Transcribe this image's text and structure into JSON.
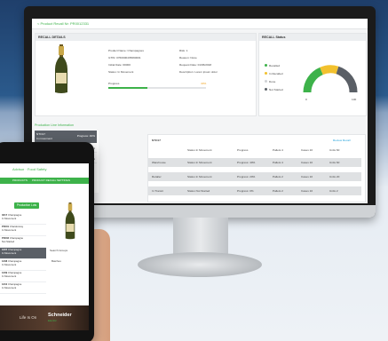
{
  "desktop": {
    "breadcrumb": "< Product Recall Nr: PR0012331",
    "recall_details": {
      "title": "RECALL DETAILS",
      "left_fields": [
        "Product Name: Champagnes",
        "GTIN: 0760000435690001",
        "Initial Date: 00000",
        "Status: In Movement"
      ],
      "right_fields": [
        "Risk: 1",
        "Reason: None",
        "Request Date: 01/06/2018",
        "Description: Lorem ipsum dolor"
      ],
      "progress_label": "Progress",
      "progress_value": "40%",
      "progress_fraction": 0.4
    },
    "recall_status": {
      "title": "RECALL Status",
      "legend": [
        "Recalled",
        "In Recalled",
        "Done",
        "Not Started"
      ],
      "legend_colors": [
        "#3db24a",
        "#f2c12e",
        "#cfd2d5",
        "#5a5f66"
      ],
      "gauge_min": "0",
      "gauge_max": "100",
      "gauge_mid": "50"
    },
    "production_line": {
      "title": "Production Line Information",
      "rows": [
        {
          "id": "NTO17",
          "sub": "In movement",
          "progress": "Progress: 40%"
        },
        {
          "id": "NTO18",
          "sub": "",
          "progress": "Progress: 30%"
        },
        {
          "id": "NTO19",
          "sub": "",
          "progress": "Progress: 20%"
        }
      ]
    },
    "table": {
      "id": "NTO17",
      "action_label": "Review Recall",
      "headers": [
        "Status In Movement",
        "Progress",
        "Pallets 4",
        "Cases 10",
        "Units 60"
      ],
      "rows": [
        [
          "Warehouse",
          "Status In Movement",
          "Progress: 40%",
          "Pallets 4",
          "Cases 10",
          "Units 60"
        ],
        [
          "Retailer",
          "Status In Movement",
          "Progress: 20%",
          "Pallets 2",
          "Cases 10",
          "Units 20"
        ],
        [
          "In Transit",
          "Status Not Started",
          "Progress: 0%",
          "Pallets 2",
          "Cases 10",
          "Units 2"
        ]
      ]
    }
  },
  "tablet": {
    "header": "Advisor · Food Safety",
    "tabs": [
      "PRODUCTS",
      "PRODUCT RECALL",
      "SETTINGS"
    ],
    "filter_button": "Production Lots",
    "list": [
      {
        "id": "0217",
        "l1": "Champagne",
        "l2": "In Movement"
      },
      {
        "id": "P0001",
        "l1": "Chardonnay",
        "l2": "In Movement"
      },
      {
        "id": "P0003",
        "l1": "Champagne",
        "l2": "Not Started"
      },
      {
        "id": "1207",
        "l1": "Champagne",
        "l2": "In Movement"
      },
      {
        "id": "1208",
        "l1": "Champagne",
        "l2": "In Movement"
      },
      {
        "id": "1209",
        "l1": "Champagne",
        "l2": "In Movement"
      },
      {
        "id": "1210",
        "l1": "Champagne",
        "l2": "In Movement"
      }
    ],
    "search_label": "Search Groups",
    "side_label": "Batches",
    "footer_tagline": "Life Is On",
    "footer_brand": "Schneider",
    "footer_sub": "Electric"
  }
}
